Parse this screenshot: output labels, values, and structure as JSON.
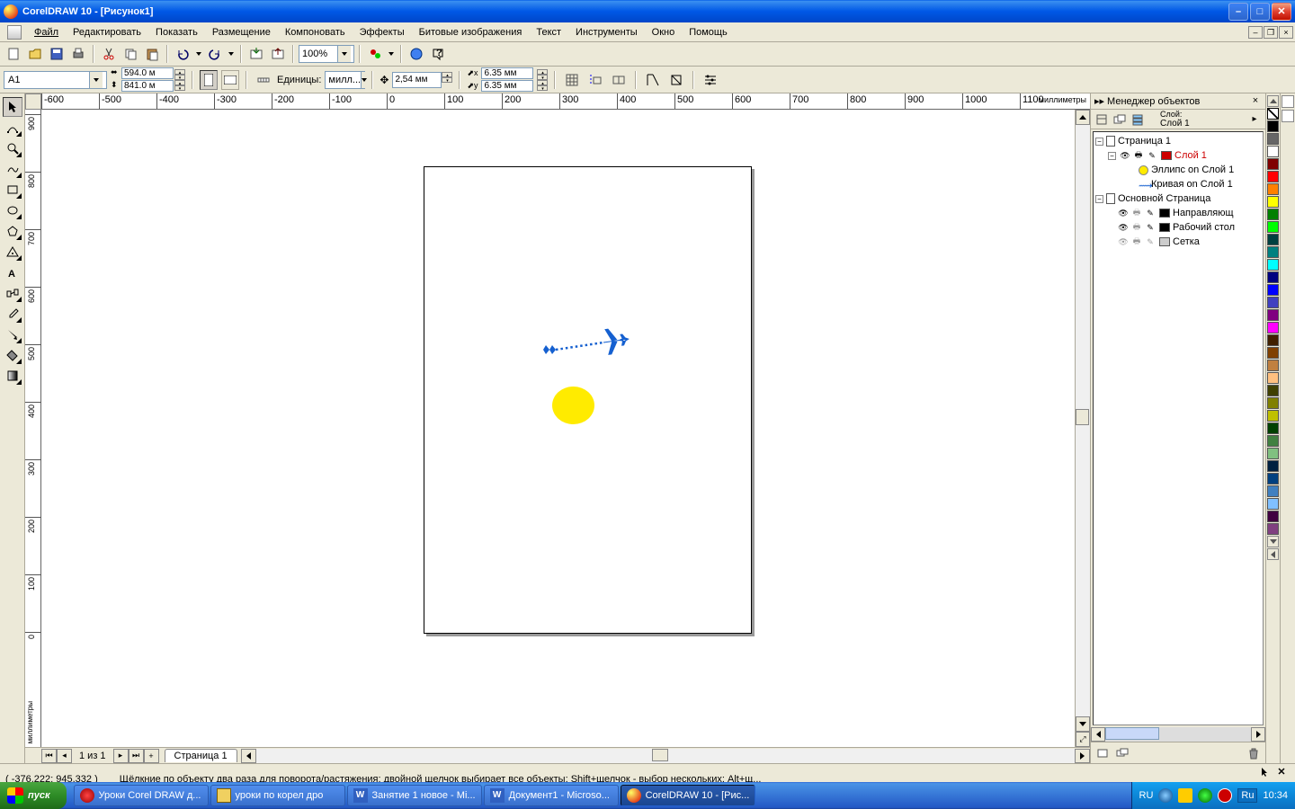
{
  "titlebar": {
    "text": "CorelDRAW 10 - [Рисунок1]"
  },
  "menu": {
    "items": [
      "Файл",
      "Редактировать",
      "Показать",
      "Размещение",
      "Компоновать",
      "Эффекты",
      "Битовые изображения",
      "Текст",
      "Инструменты",
      "Окно",
      "Помощь"
    ]
  },
  "toolbar1": {
    "zoom": "100%"
  },
  "propbar": {
    "paper": "A1",
    "width": "594.0 м",
    "height": "841.0 м",
    "units_label": "Единицы:",
    "units": "милл...",
    "nudge": "2,54 мм",
    "dup_x": "6.35 мм",
    "dup_y": "6.35 мм"
  },
  "ruler": {
    "unit_h": "миллиметры",
    "unit_v": "миллиметры",
    "h_ticks": [
      "-600",
      "-500",
      "-400",
      "-300",
      "-200",
      "-100",
      "0",
      "100",
      "200",
      "300",
      "400",
      "500",
      "600",
      "700",
      "800",
      "900",
      "1000",
      "1100"
    ],
    "v_ticks": [
      "900",
      "800",
      "700",
      "600",
      "500",
      "400",
      "300",
      "200",
      "100",
      "0"
    ]
  },
  "pagenav": {
    "info": "1 из 1",
    "tab": "Страница 1"
  },
  "docker": {
    "title": "Менеджер объектов",
    "layer_label_caption": "Слой:",
    "layer_label_value": "Слой 1",
    "tree": {
      "page": "Страница 1",
      "layer1": "Слой 1",
      "obj_ellipse": "Эллипс on Слой 1",
      "obj_curve": "Кривая on Слой 1",
      "master": "Основной Страница",
      "guides": "Направляющ",
      "desktop": "Рабочий стол",
      "grid": "Сетка"
    }
  },
  "status": {
    "coords": "( -376,222; 945,332 )",
    "hint": "Щёлкние по объекту два раза для поворота/растяжения; двойной щелчок выбирает все объекты; Shift+щелчок - выбор нескольких; Alt+щ..."
  },
  "palette_colors": [
    "#000000",
    "#666666",
    "#ffffff",
    "#800000",
    "#ff0000",
    "#ff8000",
    "#ffff00",
    "#008000",
    "#00ff00",
    "#004040",
    "#008080",
    "#00ffff",
    "#000080",
    "#0000ff",
    "#4040c0",
    "#800080",
    "#ff00ff",
    "#402000",
    "#804000",
    "#c08040",
    "#ffc080",
    "#404000",
    "#808000",
    "#c0c000",
    "#004000",
    "#408040",
    "#80c080",
    "#002040",
    "#004080",
    "#4080c0",
    "#80c0ff",
    "#400040",
    "#804080"
  ],
  "taskbar": {
    "start": "пуск",
    "items": [
      "Уроки Corel DRAW д...",
      "уроки по корел дро",
      "Занятие 1 новое - Mi...",
      "Документ1 - Microso...",
      "CorelDRAW 10 - [Рис..."
    ],
    "lang": "RU",
    "lang2": "Ru",
    "time": "10:34"
  }
}
